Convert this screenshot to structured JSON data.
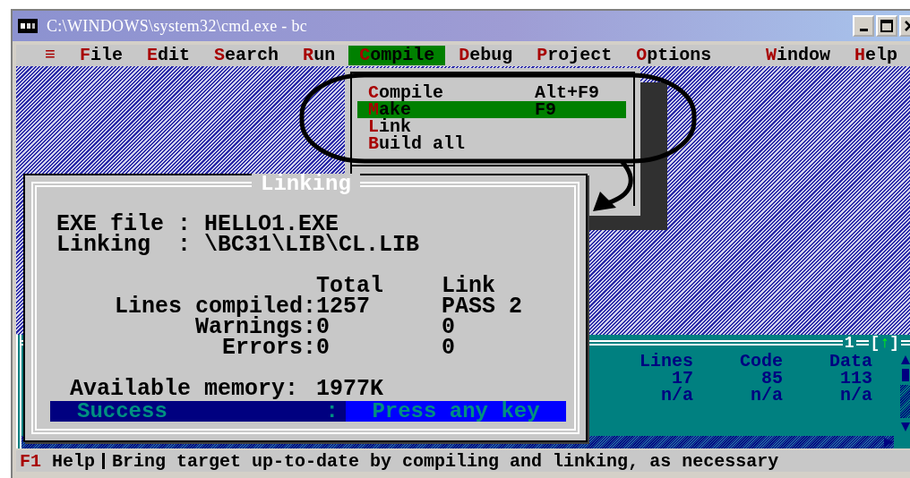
{
  "window": {
    "title": "C:\\WINDOWS\\system32\\cmd.exe - bc"
  },
  "menu": {
    "left": [
      {
        "label": "≡",
        "selected": false
      },
      {
        "label": "File",
        "selected": false
      },
      {
        "label": "Edit",
        "selected": false
      },
      {
        "label": "Search",
        "selected": false
      },
      {
        "label": "Run",
        "selected": false
      },
      {
        "label": "Compile",
        "selected": true
      },
      {
        "label": "Debug",
        "selected": false
      },
      {
        "label": "Project",
        "selected": false
      },
      {
        "label": "Options",
        "selected": false
      }
    ],
    "right": [
      {
        "label": "Window",
        "selected": false
      },
      {
        "label": "Help",
        "selected": false
      }
    ]
  },
  "compile_menu": {
    "items": [
      {
        "label": "Compile",
        "shortcut": "Alt+F9",
        "selected": false
      },
      {
        "label": "Make",
        "shortcut": "F9",
        "selected": true
      },
      {
        "label": "Link",
        "selected": false
      },
      {
        "label": "Build all",
        "selected": false
      }
    ]
  },
  "linking_dialog": {
    "title": "Linking",
    "fields": [
      {
        "label": "EXE file :",
        "value": "HELLO1.EXE"
      },
      {
        "label": "Linking  :",
        "value": "\\BC31\\LIB\\CL.LIB"
      }
    ],
    "columns": [
      "Total",
      "Link"
    ],
    "rows": [
      {
        "label": "Lines compiled:",
        "total": "1257",
        "link": "PASS 2"
      },
      {
        "label": "Warnings:",
        "total": "0",
        "link": "0"
      },
      {
        "label": "Errors:",
        "total": "0",
        "link": "0"
      }
    ],
    "memory": {
      "label": "Available memory:",
      "value": "1977K"
    },
    "status": {
      "message": "Success",
      "separator": ":",
      "prompt": "Press any key"
    }
  },
  "message_window": {
    "number": "1",
    "zoom": {
      "open": "[",
      "icon": "↑",
      "close": "]"
    },
    "columns": [
      {
        "header": "Lines",
        "values": [
          "17",
          "n/a"
        ]
      },
      {
        "header": "Code",
        "values": [
          "85",
          "n/a"
        ]
      },
      {
        "header": "Data",
        "values": [
          "113",
          "n/a"
        ]
      }
    ]
  },
  "status_bar": {
    "key": "F1",
    "key_label": "Help",
    "hint": "Bring target up-to-date by compiling and linking, as necessary"
  }
}
